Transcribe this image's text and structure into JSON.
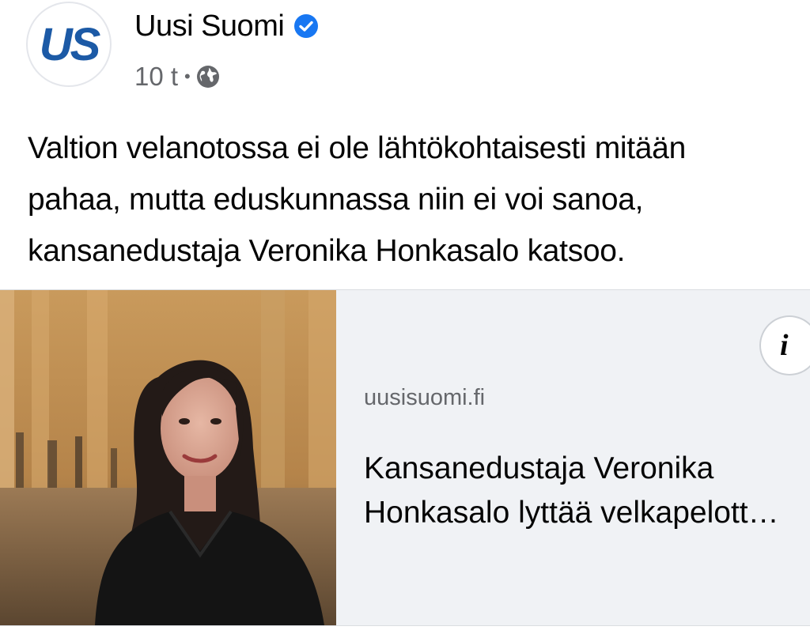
{
  "header": {
    "avatar_text": "US",
    "page_name": "Uusi Suomi",
    "time": "10 t",
    "dot": "•"
  },
  "post": {
    "text_lines": [
      "Valtion velanotossa ei ole lähtökohtaisesti mitään",
      "pahaa, mutta eduskunnassa niin ei voi sanoa,",
      "kansanedustaja Veronika Honkasalo katsoo."
    ]
  },
  "link_preview": {
    "domain": "uusisuomi.fi",
    "title_lines": [
      "Kansanedustaja Veronika",
      "Honkasalo lyttää velkapelott…"
    ],
    "info_glyph": "i"
  },
  "icons": {
    "verified": "verified-badge-icon",
    "globe": "globe-icon",
    "info": "info-icon"
  },
  "colors": {
    "brand_blue": "#1c5aa6",
    "verified_blue": "#1877f2",
    "meta_gray": "#65676b",
    "card_background": "#f0f2f5"
  }
}
